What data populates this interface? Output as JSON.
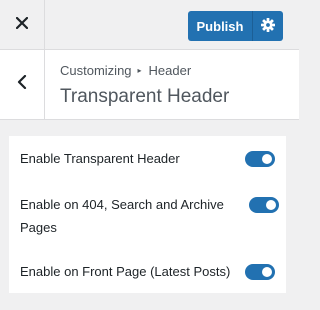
{
  "topbar": {
    "close_icon": "close-icon",
    "publish_label": "Publish",
    "settings_icon": "gear-icon"
  },
  "section": {
    "back_icon": "chevron-left-icon",
    "breadcrumb_root": "Customizing",
    "breadcrumb_separator": "▸",
    "breadcrumb_current": "Header",
    "title": "Transparent Header"
  },
  "options": [
    {
      "label": "Enable Transparent Header",
      "enabled": true
    },
    {
      "label": "Enable on 404, Search and Archive Pages",
      "enabled": true
    },
    {
      "label": "Enable on Front Page (Latest Posts)",
      "enabled": true
    }
  ],
  "colors": {
    "accent": "#2271b1",
    "background": "#f0f0f1",
    "panel": "#ffffff",
    "text": "#1d2327"
  }
}
